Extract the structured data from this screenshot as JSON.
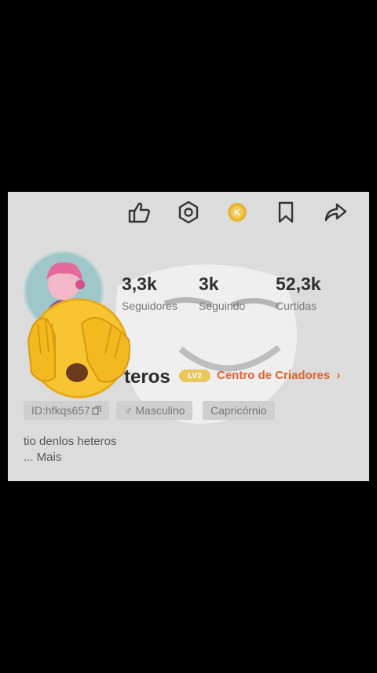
{
  "header": {
    "icons": [
      "thumbs-up-icon",
      "settings-icon",
      "coin-icon",
      "bookmark-icon",
      "share-icon"
    ]
  },
  "profile": {
    "stats": [
      {
        "value": "3,3k",
        "label": "Seguidores"
      },
      {
        "value": "3k",
        "label": "Seguindo"
      },
      {
        "value": "52,3k",
        "label": "Curtidas"
      }
    ],
    "name": "teros",
    "level_badge": "LV2",
    "creator_center": "Centro de Criadores",
    "chevron": "›",
    "chips": {
      "id": "ID:hfkqs657",
      "gender": "♂ Masculino",
      "sign": "Capricórnio"
    },
    "bio": "tio denlos heteros",
    "more": "...  Mais"
  },
  "colors": {
    "accent": "#e0622d",
    "panel": "#dcdcdc",
    "background": "#000000"
  }
}
